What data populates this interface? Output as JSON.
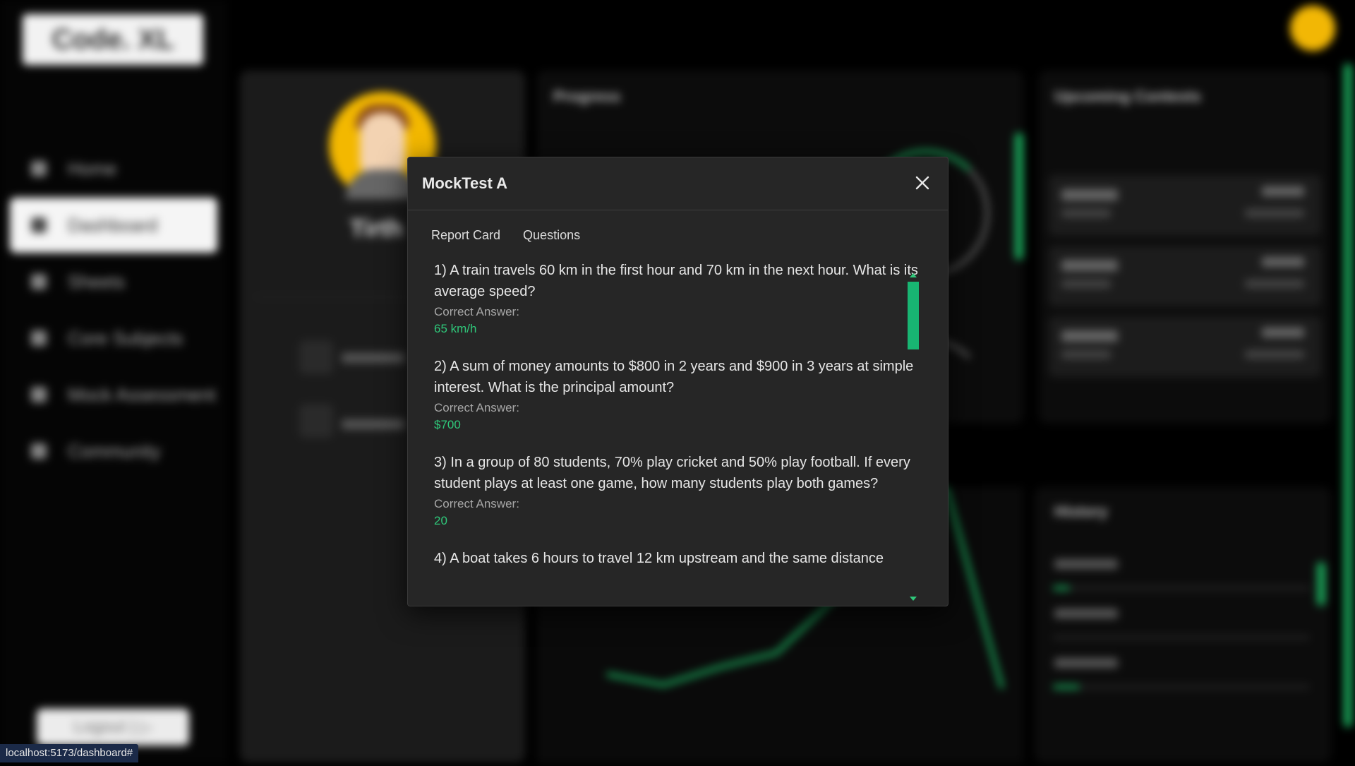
{
  "app": {
    "logo": "Code. XL",
    "status_url": "localhost:5173/dashboard#"
  },
  "sidebar": {
    "items": [
      {
        "label": "Home",
        "icon": "home-icon"
      },
      {
        "label": "Dashboard",
        "icon": "dashboard-icon",
        "active": true
      },
      {
        "label": "Sheets",
        "icon": "sheets-icon"
      },
      {
        "label": "Core Subjects",
        "icon": "book-icon"
      },
      {
        "label": "Mock Assessment",
        "icon": "assessment-icon"
      },
      {
        "label": "Community",
        "icon": "community-icon"
      }
    ],
    "logout_label": "Logout"
  },
  "profile": {
    "name": "Tirth"
  },
  "progress": {
    "title": "Progress"
  },
  "upcoming": {
    "title": "Upcoming Contests"
  },
  "history": {
    "title": "History"
  },
  "modal": {
    "title": "MockTest A",
    "tabs": [
      "Report Card",
      "Questions"
    ],
    "answer_label": "Correct Answer:",
    "questions": [
      {
        "text": "1) A train travels 60 km in the first hour and 70 km in the next hour. What is its average speed?",
        "answer": "65 km/h"
      },
      {
        "text": "2) A sum of money amounts to $800 in 2 years and $900 in 3 years at simple interest. What is the principal amount?",
        "answer": "$700"
      },
      {
        "text": "3) In a group of 80 students, 70% play cricket and 50% play football. If every student plays at least one game, how many students play both games?",
        "answer": "20"
      },
      {
        "text": "4) A boat takes 6 hours to travel 12 km upstream and the same distance"
      }
    ]
  },
  "colors": {
    "accent": "#2fc87a",
    "modal_bg": "#262626"
  }
}
